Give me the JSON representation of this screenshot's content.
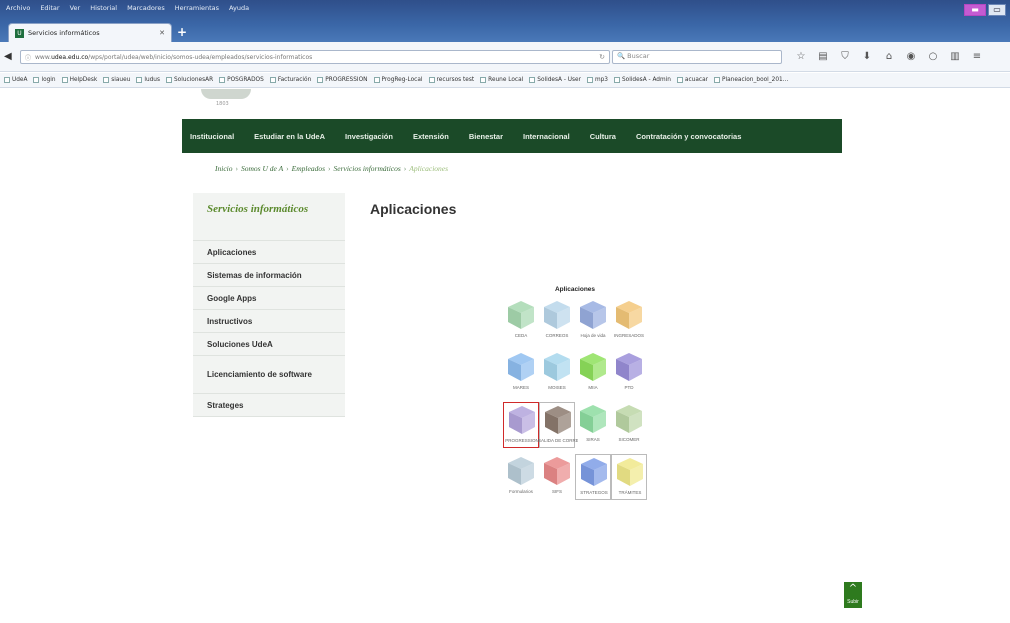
{
  "browser": {
    "menu": [
      "Archivo",
      "Editar",
      "Ver",
      "Historial",
      "Marcadores",
      "Herramientas",
      "Ayuda"
    ],
    "tab_title": "Servicios informáticos",
    "tab_favicon": "U",
    "url_prefix": "www.",
    "url_host": "udea.edu.co",
    "url_path": "/wps/portal/udea/web/inicio/somos-udea/empleados/servicios-informaticos",
    "search_placeholder": "Buscar",
    "bookmarks": [
      "UdeA",
      "login",
      "HelpDesk",
      "siaueu",
      "ludus",
      "SolucionesAR",
      "POSGRADOS",
      "Facturación",
      "PROGRESSION",
      "ProgReg-Local",
      "recursos test",
      "Reune Local",
      "SolidesA - User",
      "mp3",
      "SolidesA - Admin",
      "acuacar",
      "Planeacion_bool_201..."
    ]
  },
  "page": {
    "logo_year": "1803",
    "main_nav": [
      "Institucional",
      "Estudiar en la UdeA",
      "Investigación",
      "Extensión",
      "Bienestar",
      "Internacional",
      "Cultura",
      "Contratación y convocatorias"
    ],
    "breadcrumb": [
      "Inicio",
      "Somos U de A",
      "Empleados",
      "Servicios informáticos"
    ],
    "breadcrumb_current": "Aplicaciones",
    "sidebar": {
      "title": "Servicios informáticos",
      "items": [
        "Aplicaciones",
        "Sistemas de información",
        "Google Apps",
        "Instructivos",
        "Soluciones UdeA",
        "Licenciamiento de software",
        "Strateges"
      ]
    },
    "content_title": "Aplicaciones",
    "apps_title": "Aplicaciones",
    "apps": [
      {
        "label": "CEDA",
        "color": "#a7d8b0"
      },
      {
        "label": "CORREOS",
        "color": "#b9d6ea"
      },
      {
        "label": "Hoja de vida",
        "color": "#98aee0"
      },
      {
        "label": "INGRESADOS",
        "color": "#f3c77a"
      },
      {
        "label": "MARES",
        "color": "#8fbef0"
      },
      {
        "label": "MOISES",
        "color": "#a6d6ec"
      },
      {
        "label": "MIIA",
        "color": "#8ee05c"
      },
      {
        "label": "PTD",
        "color": "#9a8ed8"
      },
      {
        "label": "PROGRESSION",
        "color": "#b3a4dc"
      },
      {
        "label": "SALIDA DE CORREO",
        "color": "#8c7a6e"
      },
      {
        "label": "SIRAS",
        "color": "#8ddca0"
      },
      {
        "label": "SICOMER",
        "color": "#bcd6a6"
      },
      {
        "label": "Formularios",
        "color": "#b8ccd8"
      },
      {
        "label": "SIFS",
        "color": "#e98a8a"
      },
      {
        "label": "STRATEGOS",
        "color": "#7e9de6"
      },
      {
        "label": "TRÁMITES",
        "color": "#f0e88a"
      }
    ],
    "scroll_top_label": "Subir"
  }
}
